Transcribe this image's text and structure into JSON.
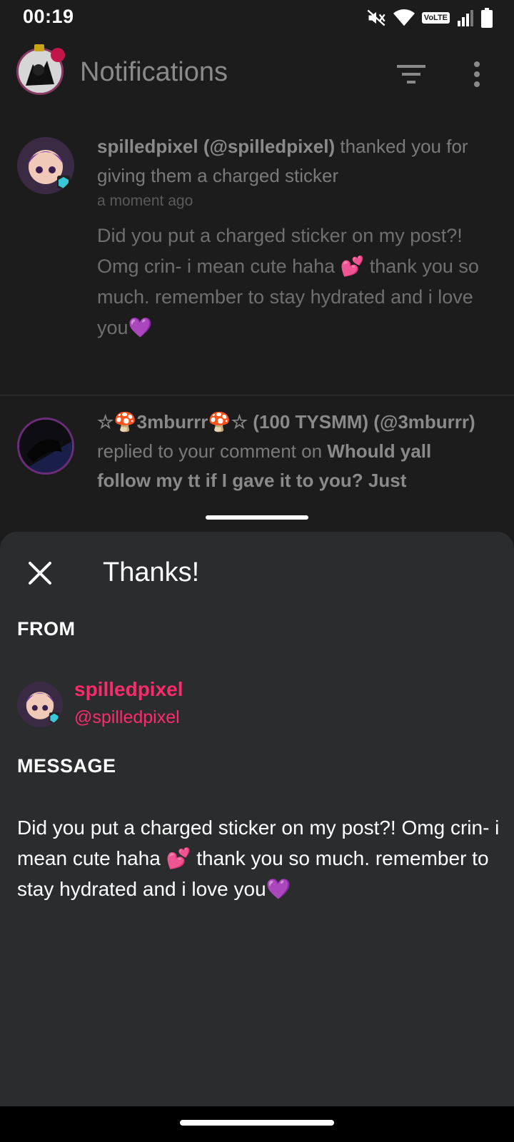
{
  "status_bar": {
    "time": "00:19",
    "network_badge": "VoLTE",
    "icons": [
      "mute-icon",
      "wifi-icon",
      "signal-icon",
      "battery-icon"
    ]
  },
  "app_bar": {
    "title": "Notifications",
    "icons": [
      "filter-icon",
      "more-vert-icon"
    ]
  },
  "notifications": [
    {
      "actor": "spilledpixel (@spilledpixel)",
      "action": "thanked you for giving them a charged sticker",
      "timestamp": "a moment ago",
      "message": "Did you put a charged sticker on my post?! Omg crin- i mean cute haha 💕 thank you so much.  remember to stay hydrated and i love you💜"
    },
    {
      "actor": "☆🍄3mburrr🍄☆ (100 TYSMM) (@3mburrr)",
      "action": "replied to your comment on",
      "target": "Whould yall follow my tt if I gave it to you? Just"
    }
  ],
  "sheet": {
    "title": "Thanks!",
    "from_label": "FROM",
    "from_name": "spilledpixel",
    "from_handle": "@spilledpixel",
    "message_label": "MESSAGE",
    "message": "Did you put a charged sticker on my post?! Omg crin- i mean cute haha 💕 thank you so much.  remember to stay hydrated and i love you💜"
  },
  "colors": {
    "background": "#1c1c1c",
    "sheet_background": "#2a2c2d",
    "accent_pink": "#ff2a6d"
  }
}
